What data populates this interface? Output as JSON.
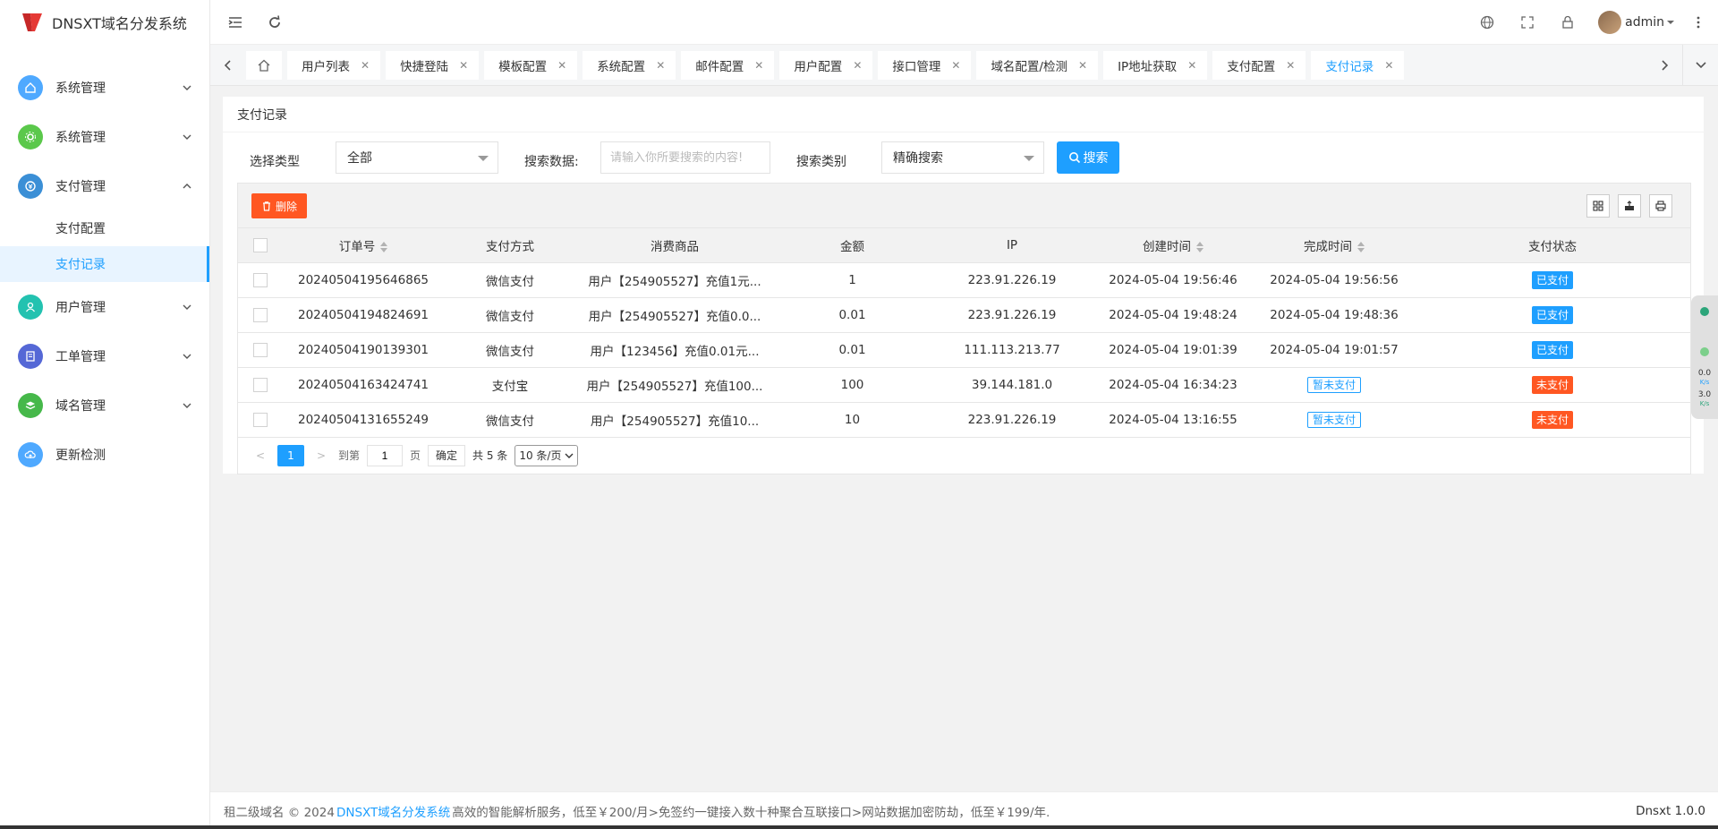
{
  "app": {
    "title": "DNSXT域名分发系统"
  },
  "sidebar": {
    "items": [
      {
        "label": "系统管理",
        "icon": "home-icon",
        "color": "#4fa9ff"
      },
      {
        "label": "系统管理",
        "icon": "gear-icon",
        "color": "#5bc84b"
      },
      {
        "label": "支付管理",
        "icon": "pay-icon",
        "color": "#3b8fd6"
      },
      {
        "label": "用户管理",
        "icon": "user-icon",
        "color": "#23c2b0"
      },
      {
        "label": "工单管理",
        "icon": "ticket-icon",
        "color": "#5568d6"
      },
      {
        "label": "域名管理",
        "icon": "layers-icon",
        "color": "#46b84a"
      },
      {
        "label": "更新检测",
        "icon": "cloud-icon",
        "color": "#4fa9ff"
      }
    ],
    "submenu": [
      {
        "label": "支付配置"
      },
      {
        "label": "支付记录"
      }
    ]
  },
  "topbar": {
    "user": "admin"
  },
  "tabs": [
    {
      "label": "用户列表"
    },
    {
      "label": "快捷登陆"
    },
    {
      "label": "模板配置"
    },
    {
      "label": "系统配置"
    },
    {
      "label": "邮件配置"
    },
    {
      "label": "用户配置"
    },
    {
      "label": "接口管理"
    },
    {
      "label": "域名配置/检测"
    },
    {
      "label": "IP地址获取"
    },
    {
      "label": "支付配置"
    },
    {
      "label": "支付记录"
    }
  ],
  "page": {
    "title": "支付记录",
    "filters": {
      "type_label": "选择类型",
      "type_value": "全部",
      "data_label": "搜索数据:",
      "data_placeholder": "请输入你所要搜索的内容!",
      "category_label": "搜索类别",
      "category_value": "精确搜索",
      "search_button": "搜索"
    },
    "toolbar": {
      "delete_button": "删除"
    },
    "table": {
      "headers": [
        "订单号",
        "支付方式",
        "消费商品",
        "金额",
        "IP",
        "创建时间",
        "完成时间",
        "支付状态"
      ],
      "rows": [
        {
          "order": "20240504195646865",
          "method": "微信支付",
          "product": "用户【254905527】充值1元...",
          "amount": "1",
          "ip": "223.91.226.19",
          "created": "2024-05-04 19:56:46",
          "finished": "2024-05-04 19:56:56",
          "status": "已支付",
          "status_type": "paid"
        },
        {
          "order": "20240504194824691",
          "method": "微信支付",
          "product": "用户【254905527】充值0.0...",
          "amount": "0.01",
          "ip": "223.91.226.19",
          "created": "2024-05-04 19:48:24",
          "finished": "2024-05-04 19:48:36",
          "status": "已支付",
          "status_type": "paid"
        },
        {
          "order": "20240504190139301",
          "method": "微信支付",
          "product": "用户【123456】充值0.01元...",
          "amount": "0.01",
          "ip": "111.113.213.77",
          "created": "2024-05-04 19:01:39",
          "finished": "2024-05-04 19:01:57",
          "status": "已支付",
          "status_type": "paid"
        },
        {
          "order": "20240504163424741",
          "method": "支付宝",
          "product": "用户【254905527】充值100...",
          "amount": "100",
          "ip": "39.144.181.0",
          "created": "2024-05-04 16:34:23",
          "finished": "暂未支付",
          "status": "未支付",
          "status_type": "unpaid"
        },
        {
          "order": "20240504131655249",
          "method": "微信支付",
          "product": "用户【254905527】充值10...",
          "amount": "10",
          "ip": "223.91.226.19",
          "created": "2024-05-04 13:16:55",
          "finished": "暂未支付",
          "status": "未支付",
          "status_type": "unpaid"
        }
      ]
    },
    "pager": {
      "current": "1",
      "goto_label": "到第",
      "goto_value": "1",
      "page_label": "页",
      "confirm": "确定",
      "total": "共 5 条",
      "per_page": "10 条/页"
    }
  },
  "widget": {
    "down": "0.0",
    "up": "3.0",
    "unit": "K/s"
  },
  "footer": {
    "prefix": "租二级域名 © 2024",
    "link": "DNSXT域名分发系统",
    "text": "高效的智能解析服务，低至￥200/月>免签约一键接入数十种聚合互联接口>网站数据加密防劫，低至￥199/年.",
    "version": "Dnsxt 1.0.0"
  }
}
